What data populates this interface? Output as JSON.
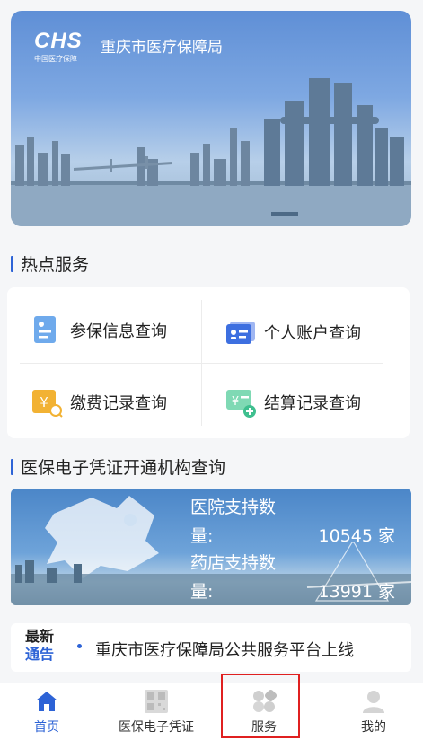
{
  "banner": {
    "logo_text": "CHS",
    "logo_sub": "中国医疗保障",
    "org_name": "重庆市医疗保障局"
  },
  "hot_services": {
    "title": "热点服务",
    "items": [
      {
        "label": "参保信息查询",
        "icon": "insurance-info-icon",
        "color": "#5b9be8"
      },
      {
        "label": "个人账户查询",
        "icon": "personal-account-icon",
        "color": "#3d6fe0"
      },
      {
        "label": "缴费记录查询",
        "icon": "payment-record-icon",
        "color": "#f2b233"
      },
      {
        "label": "结算记录查询",
        "icon": "settlement-record-icon",
        "color": "#3fbf8f"
      }
    ]
  },
  "cert_section": {
    "title": "医保电子凭证开通机构查询",
    "hospital_label_1": "医院支持数",
    "hospital_label_2": "量:",
    "hospital_count": "10545 家",
    "pharmacy_label_1": "药店支持数",
    "pharmacy_label_2": "量:",
    "pharmacy_count": "13991 家"
  },
  "notice": {
    "tag_line1": "最新",
    "tag_line2": "通告",
    "message": "重庆市医疗保障局公共服务平台上线"
  },
  "tabbar": {
    "tabs": [
      {
        "label": "首页",
        "icon": "home-icon",
        "active": true
      },
      {
        "label": "医保电子凭证",
        "icon": "qr-code-icon",
        "active": false
      },
      {
        "label": "服务",
        "icon": "services-icon",
        "active": false
      },
      {
        "label": "我的",
        "icon": "profile-icon",
        "active": false
      }
    ]
  },
  "colors": {
    "accent": "#2d63d6",
    "highlight": "#e02020"
  }
}
